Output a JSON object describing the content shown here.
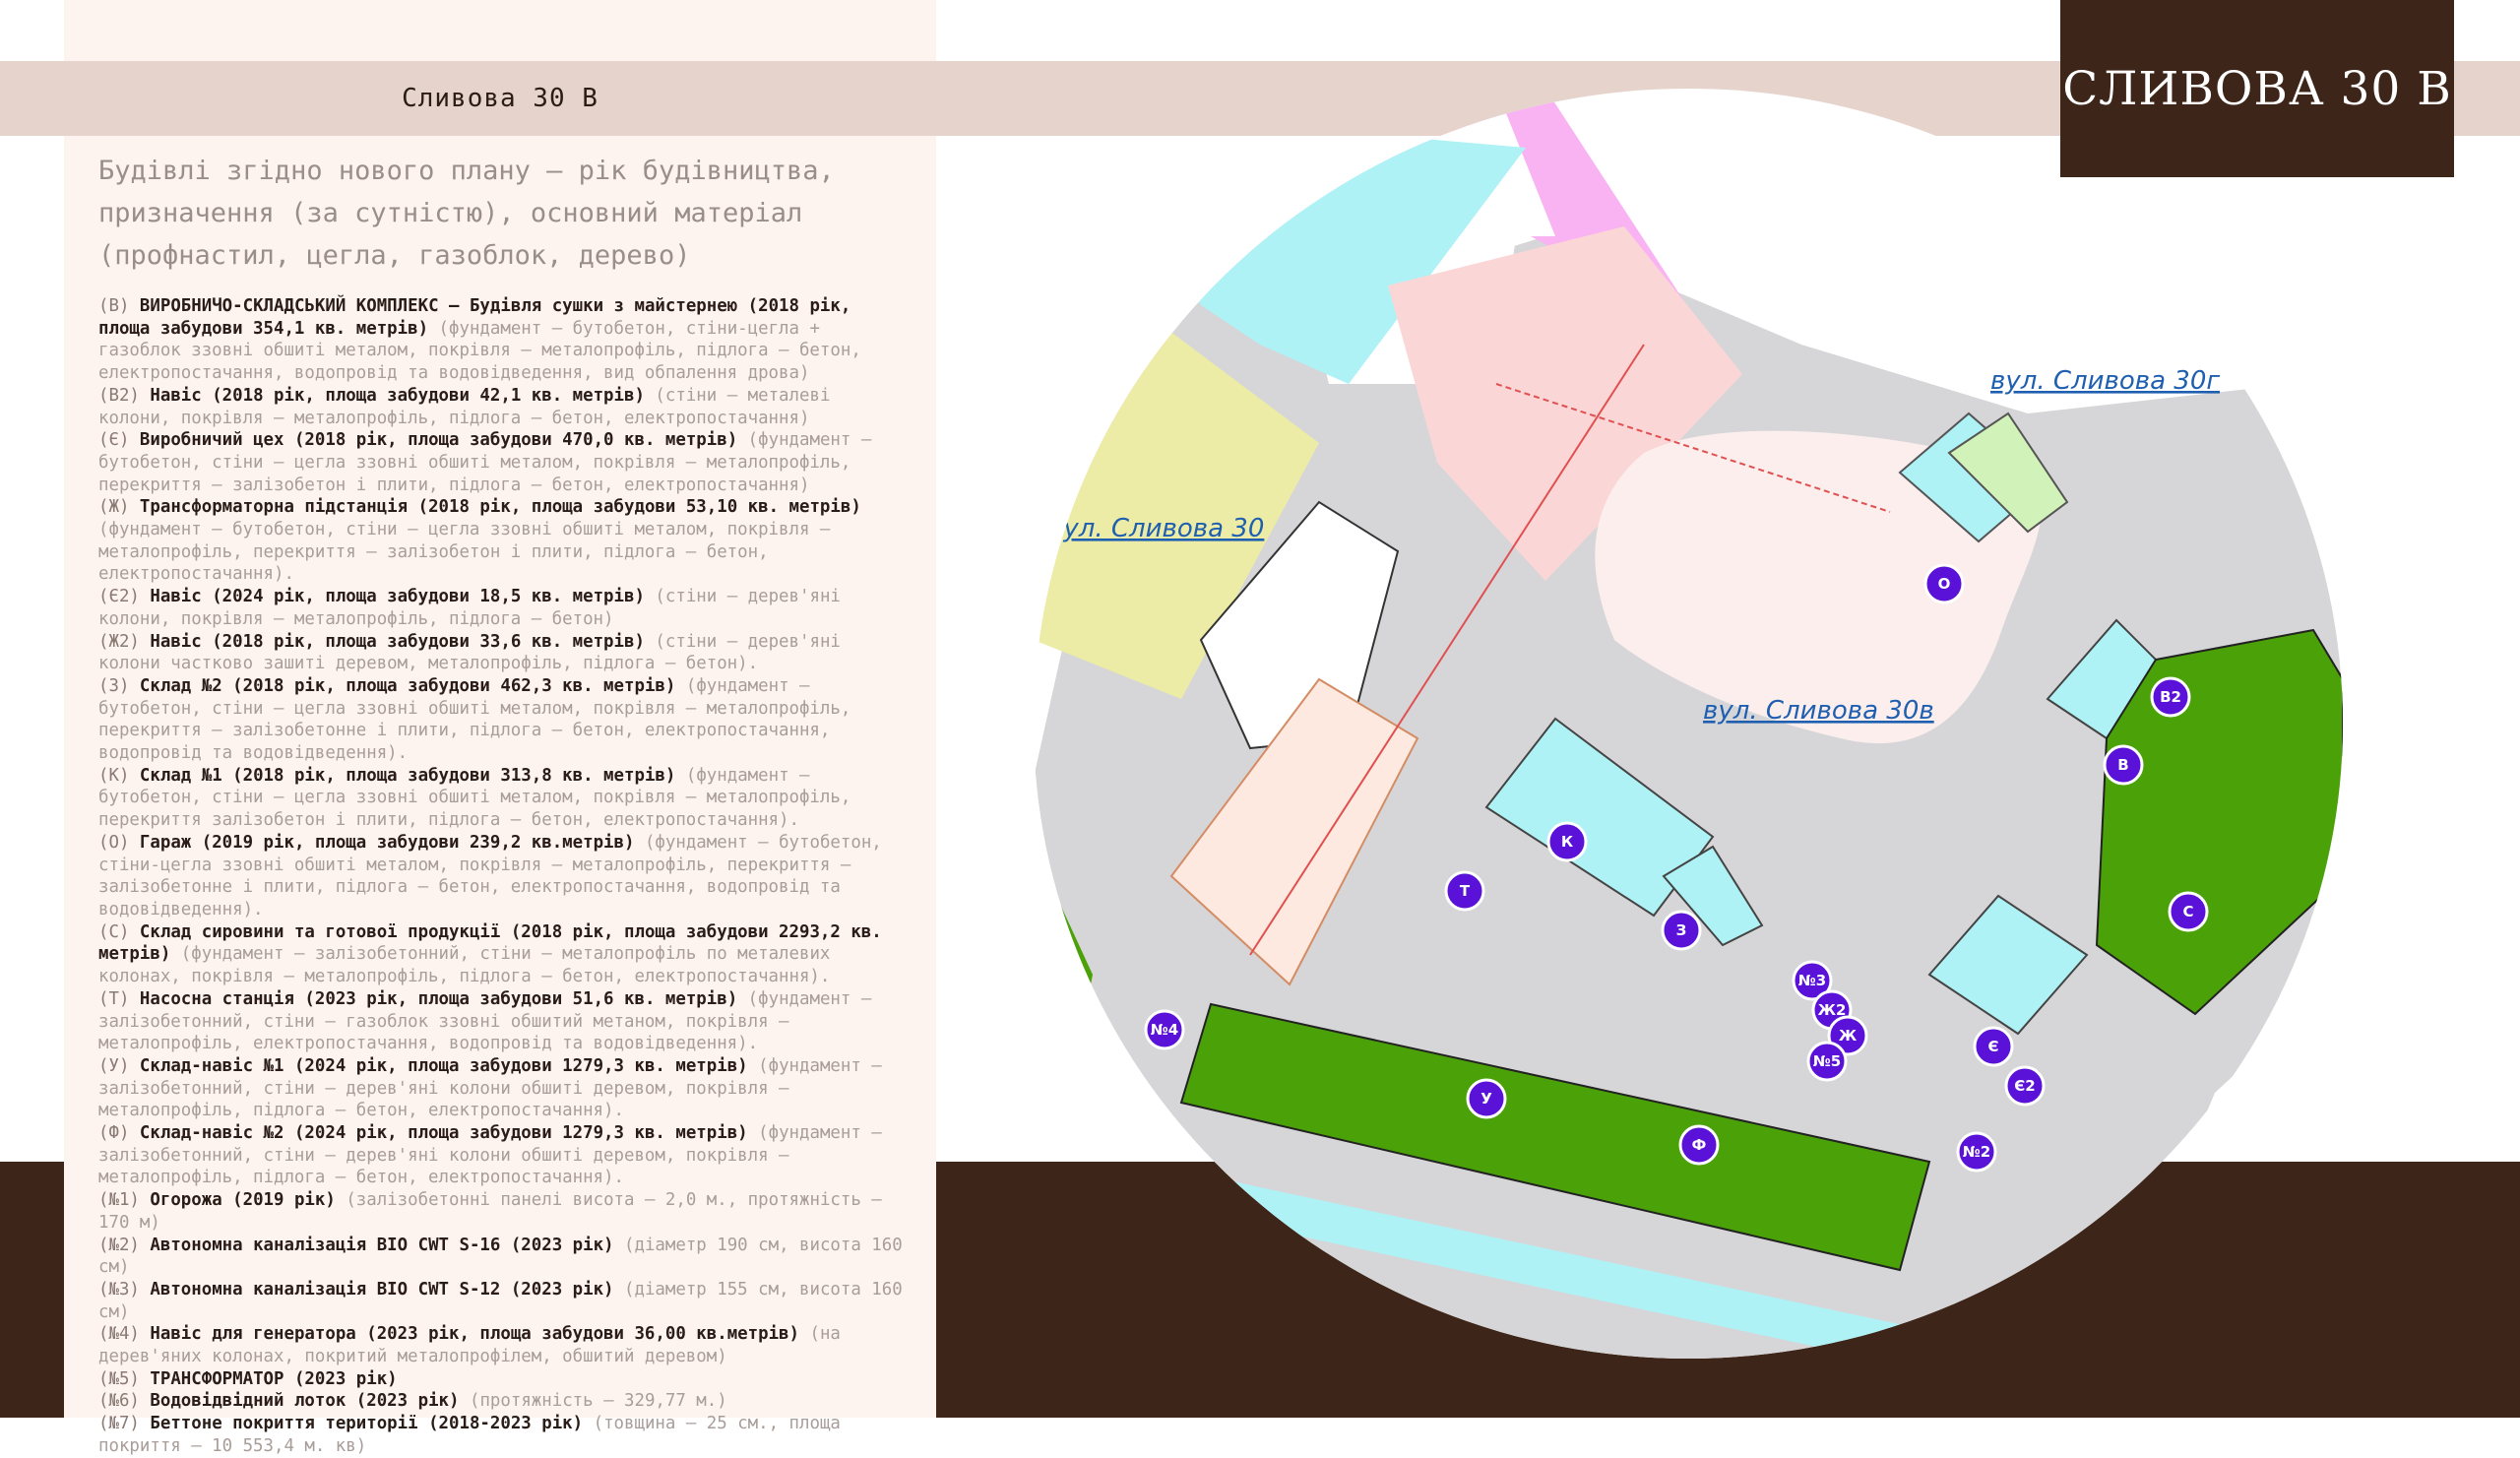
{
  "header": {
    "panel_title": "Сливова 30 В",
    "brand_title": "СЛИВОВА 30 В"
  },
  "subtitle": "Будівлі згідно нового плану – рік будівництва, призначення (за сутністю), основний матеріал (профнастил, цегла, газоблок, дерево)",
  "buildings": [
    {
      "code": "(В)",
      "title": "ВИРОБНИЧО-СКЛАДСЬКИЙ КОМПЛЕКС – Будівля сушки з майстернею (2018 рік, площа забудови 354,1 кв. метрів)",
      "details": "(фундамент – бутобетон, стіни-цегла + газоблок ззовні обшиті металом, покрівля – металопрофіль, підлога – бетон, електропостачання, водопровід та водовідведення, вид обпалення дрова)"
    },
    {
      "code": "(В2)",
      "title": "Навіс (2018 рік, площа забудови 42,1 кв. метрів)",
      "details": "(стіни – металеві колони, покрівля – металопрофіль, підлога – бетон, електропостачання)"
    },
    {
      "code": "(Є)",
      "title": "Виробничий цех (2018 рік, площа забудови 470,0 кв. метрів)",
      "details": "(фундамент – бутобетон, стіни – цегла ззовні обшиті металом, покрівля – металопрофіль, перекриття – залізобетон і плити, підлога – бетон, електропостачання)"
    },
    {
      "code": "(Ж)",
      "title": "Трансформаторна підстанція (2018 рік, площа забудови 53,10 кв. метрів)",
      "details": "(фундамент – бутобетон, стіни – цегла ззовні обшиті металом, покрівля – металопрофіль, перекриття – залізобетон і плити, підлога – бетон, електропостачання)."
    },
    {
      "code": "(Є2)",
      "title": " Навіс (2024 рік, площа забудови 18,5 кв. метрів)",
      "details": "(стіни – дерев'яні колони, покрівля – металопрофіль, підлога – бетон)"
    },
    {
      "code": "(Ж2)",
      "title": "Навіс (2018 рік, площа забудови 33,6 кв. метрів)",
      "details": "(стіни – дерев'яні колони частково зашиті деревом, металопрофіль, підлога – бетон)."
    },
    {
      "code": "(З)",
      "title": "Склад №2 (2018 рік, площа забудови 462,3 кв. метрів)",
      "details": "(фундамент – бутобетон, стіни – цегла ззовні обшиті металом, покрівля – металопрофіль, перекриття – залізобетонне і плити, підлога – бетон, електропостачання, водопровід та водовідведення)."
    },
    {
      "code": "(К)",
      "title": "Склад №1 (2018 рік, площа забудови 313,8 кв. метрів)",
      "details": "(фундамент – бутобетон, стіни – цегла ззовні обшиті металом, покрівля – металопрофіль, перекриття залізобетон і плити, підлога – бетон, електропостачання)."
    },
    {
      "code": "(О)",
      "title": "Гараж (2019 рік, площа забудови 239,2 кв.метрів)",
      "details": "(фундамент – бутобетон, стіни-цегла ззовні обшиті металом, покрівля – металопрофіль, перекриття – залізобетонне і плити, підлога – бетон, електропостачання, водопровід та водовідведення)."
    },
    {
      "code": "(С)",
      "title": "Склад сировини та готової продукції (2018 рік, площа забудови 2293,2 кв. метрів)",
      "details": "(фундамент – залізобетонний, стіни – металопрофіль по металевих колонах, покрівля – металопрофіль, підлога – бетон, електропостачання)."
    },
    {
      "code": "(Т)",
      "title": "Насосна станція (2023 рік, площа забудови 51,6 кв. метрів)",
      "details": "(фундамент – залізобетонний, стіни – газоблок ззовні обшитий метаном, покрівля – металопрофіль, електропостачання, водопровід та водовідведення)."
    },
    {
      "code": "(У)",
      "title": "Склад-навіс №1 (2024 рік, площа забудови 1279,3 кв. метрів)",
      "details": "(фундамент – залізобетонний, стіни – дерев'яні колони обшиті деревом, покрівля – металопрофіль, підлога – бетон, електропостачання)."
    },
    {
      "code": "(Ф)",
      "title": "Склад-навіс №2 (2024 рік, площа забудови 1279,3 кв. метрів)",
      "details": "(фундамент – залізобетонний, стіни – дерев'яні колони обшиті деревом, покрівля – металопрофіль, підлога – бетон, електропостачання)."
    },
    {
      "code": "(№1)",
      "title": "Огорожа (2019 рік)",
      "details": "(залізобетонні панелі висота – 2,0 м., протяжність – 170 м)"
    },
    {
      "code": "(№2)",
      "title": "Автономна каналізація BIO CWT S-16 (2023 рік)",
      "details": "(діаметр 190 см, висота 160 см)"
    },
    {
      "code": "(№3)",
      "title": "Автономна каналізація BIO CWT S-12 (2023 рік)",
      "details": "(діаметр 155 см, висота 160 см)"
    },
    {
      "code": "(№4)",
      "title": "Навіс для генератора (2023 рік, площа забудови 36,00 кв.метрів)",
      "details": "(на дерев'яних колонах, покритий металопрофілем, обшитий деревом)"
    },
    {
      "code": "(№5)",
      "title": "ТРАНСФОРМАТОР (2023 рік)",
      "details": ""
    },
    {
      "code": "(№6)",
      "title": "Водовідвідний лоток (2023 рік)",
      "details": "(протяжність – 329,77 м.)"
    },
    {
      "code": "(№7)",
      "title": "Беттоне покриття території (2018-2023 рік)",
      "details": "(товщина – 25 см., площа покриття – 10 553,4 м. кв)"
    }
  ],
  "map": {
    "streets": {
      "s30": "вул. Сливова 30",
      "s30g": "вул. Сливова 30г",
      "s30v": "вул. Сливова 30в"
    },
    "markers": [
      "В2",
      "В",
      "С",
      "О",
      "К",
      "Т",
      "З",
      "№3",
      "Ж2",
      "Ж",
      "№5",
      "Є",
      "Є2",
      "№2",
      "У",
      "Ф",
      "№4"
    ],
    "colors": {
      "marker": "#5a12d8",
      "green": "#4aa108",
      "cyan": "#aef2f6",
      "pink": "#fbd6d6",
      "magenta": "#f9b3f3",
      "yellow": "#ececa6"
    }
  }
}
